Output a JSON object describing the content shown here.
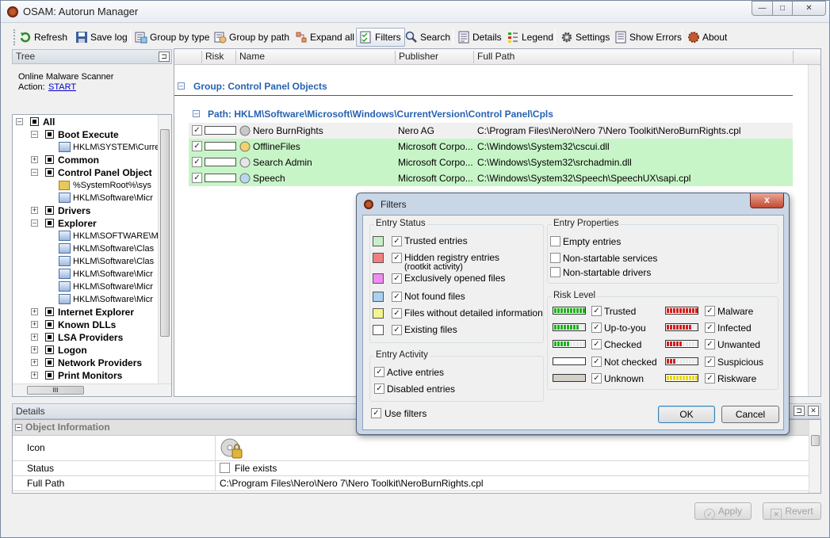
{
  "window": {
    "title": "OSAM: Autorun Manager",
    "min": "—",
    "max": "□",
    "close": "✕"
  },
  "toolbar": {
    "refresh": "Refresh",
    "save_log": "Save log",
    "group_by_type": "Group by type",
    "group_by_path": "Group by path",
    "expand_all": "Expand all",
    "filters": "Filters",
    "search": "Search",
    "details": "Details",
    "legend": "Legend",
    "settings": "Settings",
    "show_errors": "Show Errors",
    "about": "About"
  },
  "tree_panel": {
    "header": "Tree",
    "scanner_label": "Online Malware Scanner",
    "action_label": "Action:",
    "action_link": "START",
    "hscroll_grip": "III",
    "items": [
      {
        "label": "All"
      },
      {
        "label": "Boot Execute"
      },
      {
        "label": "HKLM\\SYSTEM\\Curre"
      },
      {
        "label": "Common"
      },
      {
        "label": "Control Panel Object"
      },
      {
        "label": "%SystemRoot%\\sys"
      },
      {
        "label": "HKLM\\Software\\Micr"
      },
      {
        "label": "Drivers"
      },
      {
        "label": "Explorer"
      },
      {
        "label": "HKLM\\SOFTWARE\\M"
      },
      {
        "label": "HKLM\\Software\\Clas"
      },
      {
        "label": "HKLM\\Software\\Clas"
      },
      {
        "label": "HKLM\\Software\\Micr"
      },
      {
        "label": "HKLM\\Software\\Micr"
      },
      {
        "label": "HKLM\\Software\\Micr"
      },
      {
        "label": "Internet Explorer"
      },
      {
        "label": "Known DLLs"
      },
      {
        "label": "LSA Providers"
      },
      {
        "label": "Logon"
      },
      {
        "label": "Network Providers"
      },
      {
        "label": "Print Monitors"
      }
    ]
  },
  "grid": {
    "columns": {
      "risk": "Risk",
      "name": "Name",
      "publisher": "Publisher",
      "full_path": "Full Path"
    },
    "group": "Group: Control Panel Objects",
    "path": "Path: HKLM\\Software\\Microsoft\\Windows\\CurrentVersion\\Control Panel\\Cpls",
    "rows": [
      {
        "name": "Nero BurnRights",
        "publisher": "Nero AG",
        "path": "C:\\Program Files\\Nero\\Nero 7\\Nero Toolkit\\NeroBurnRights.cpl",
        "checked": "✓"
      },
      {
        "name": "OfflineFiles",
        "publisher": "Microsoft Corpo...",
        "path": "C:\\Windows\\System32\\cscui.dll",
        "checked": "✓"
      },
      {
        "name": "Search Admin",
        "publisher": "Microsoft Corpo...",
        "path": "C:\\Windows\\System32\\srchadmin.dll",
        "checked": "✓"
      },
      {
        "name": "Speech",
        "publisher": "Microsoft Corpo...",
        "path": "C:\\Windows\\System32\\Speech\\SpeechUX\\sapi.cpl",
        "checked": "✓"
      }
    ]
  },
  "details": {
    "header": "Details",
    "section": "Object Information",
    "icon_label": "Icon",
    "status_label": "Status",
    "status_value": "File exists",
    "full_path_label": "Full Path",
    "full_path_value": "C:\\Program Files\\Nero\\Nero 7\\Nero Toolkit\\NeroBurnRights.cpl"
  },
  "bottom": {
    "apply": "Apply",
    "revert": "Revert"
  },
  "dialog": {
    "title": "Filters",
    "close": "x",
    "entry_status": {
      "title": "Entry Status",
      "items": [
        {
          "label": "Trusted entries",
          "color": "#c8f0c8",
          "checked": "✓"
        },
        {
          "label": "Hidden registry entries",
          "label2": "(rootkit activity)",
          "color": "#f08080",
          "checked": "✓"
        },
        {
          "label": "Exclusively opened files",
          "color": "#f08cf0",
          "checked": "✓"
        },
        {
          "label": "Not found files",
          "color": "#a8d0f0",
          "checked": "✓"
        },
        {
          "label": "Files without detailed information",
          "color": "#f5f590",
          "checked": "✓"
        },
        {
          "label": "Existing files",
          "color": "#ffffff",
          "checked": "✓"
        }
      ]
    },
    "entry_activity": {
      "title": "Entry Activity",
      "items": [
        {
          "label": "Active entries",
          "checked": "✓"
        },
        {
          "label": "Disabled entries",
          "checked": "✓"
        }
      ]
    },
    "use_filters": {
      "label": "Use filters",
      "checked": "✓"
    },
    "entry_properties": {
      "title": "Entry Properties",
      "items": [
        {
          "label": "Empty entries",
          "checked": ""
        },
        {
          "label": "Non-startable services",
          "checked": ""
        },
        {
          "label": "Non-startable drivers",
          "checked": ""
        }
      ]
    },
    "risk_level": {
      "title": "Risk Level",
      "left": [
        {
          "label": "Trusted",
          "checked": "✓",
          "fill": 1.0,
          "color": "#20b020"
        },
        {
          "label": "Up-to-you",
          "checked": "✓",
          "fill": 0.75,
          "color": "#20b020"
        },
        {
          "label": "Checked",
          "checked": "✓",
          "fill": 0.5,
          "color": "#20b020"
        },
        {
          "label": "Not checked",
          "checked": "✓",
          "fill": 0.0,
          "color": "#ffffff"
        },
        {
          "label": "Unknown",
          "checked": "✓",
          "fill": 1.0,
          "color": "#d4d0c8"
        }
      ],
      "right": [
        {
          "label": "Malware",
          "checked": "✓",
          "fill": 1.0,
          "color": "#d02020"
        },
        {
          "label": "Infected",
          "checked": "✓",
          "fill": 0.75,
          "color": "#d02020"
        },
        {
          "label": "Unwanted",
          "checked": "✓",
          "fill": 0.5,
          "color": "#d02020"
        },
        {
          "label": "Suspicious",
          "checked": "✓",
          "fill": 0.25,
          "color": "#d02020"
        },
        {
          "label": "Riskware",
          "checked": "✓",
          "fill": 1.0,
          "color": "#e8d820"
        }
      ]
    },
    "ok": "OK",
    "cancel": "Cancel"
  }
}
